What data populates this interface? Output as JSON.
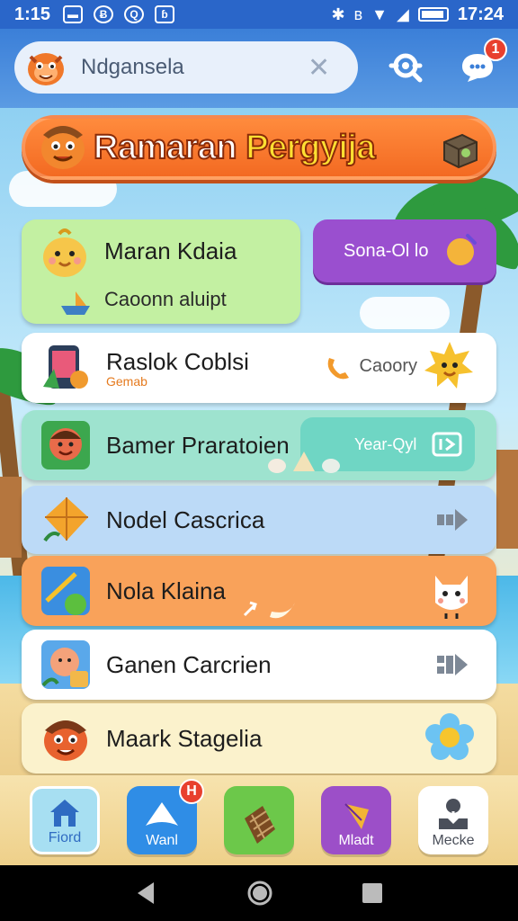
{
  "status_bar": {
    "time_left": "1:15",
    "time_right": "17:24",
    "left_icon_glyphs": [
      "▬",
      "Ƀ",
      "Q",
      "ɓ"
    ]
  },
  "search": {
    "value": "Ndgansela",
    "placeholder": "Ndgansela"
  },
  "header": {
    "notification_count": "1"
  },
  "banner": {
    "title_part1": "Ramaran ",
    "title_part2": "Pergyija"
  },
  "featured": {
    "title": "Maran Kdaia",
    "subtitle": "Caoonn aluipt",
    "pill_label": "Sona-Ol lo"
  },
  "list": [
    {
      "title": "Raslok Coblsi",
      "tag": "Gemab",
      "action": "Caoory"
    },
    {
      "title": "Bamer Praratoien",
      "action": "Year-Qyl"
    },
    {
      "title": "Nodel Cascrica"
    },
    {
      "title": "Nola Klaina"
    },
    {
      "title": "Ganen Carcrien"
    },
    {
      "title": "Maark Stagelia"
    }
  ],
  "bottom_nav": [
    {
      "label": "Fiord"
    },
    {
      "label": "Wanl",
      "badge": "H"
    },
    {
      "label": ""
    },
    {
      "label": "Mladt"
    },
    {
      "label": "Mecke"
    }
  ],
  "colors": {
    "appbar": "#3b7fd8",
    "banner": "#f36a22",
    "featured_card": "#bff0a0",
    "pill": "#9a4fcf",
    "row_teal": "#9ee3cf",
    "row_blue": "#bcdaf7",
    "row_orange": "#f9a25a",
    "row_cream": "#fbf2cc"
  }
}
